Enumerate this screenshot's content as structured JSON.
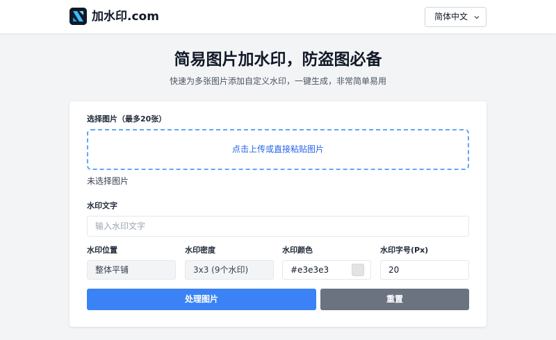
{
  "header": {
    "logo_icon": "brand-logo-icon",
    "brand": "加水印.com",
    "language": "简体中文"
  },
  "hero": {
    "title": "简易图片加水印，防盗图必备",
    "subtitle": "快速为多张图片添加自定义水印，一键生成，非常简单易用"
  },
  "form": {
    "image_label": "选择图片（最多20张）",
    "upload_text": "点击上传或直接粘贴图片",
    "no_image_text": "未选择图片",
    "text_label": "水印文字",
    "text_placeholder": "输入水印文字",
    "text_value": "",
    "position_label": "水印位置",
    "position_value": "整体平铺",
    "density_label": "水印密度",
    "density_value": "3x3 (9个水印)",
    "color_label": "水印颜色",
    "color_value": "#e3e3e3",
    "size_label": "水印字号(Px)",
    "size_value": "20",
    "process_button": "处理图片",
    "reset_button": "重置"
  },
  "colors": {
    "primary": "#3b82f6",
    "secondary": "#6b7280",
    "dropzone_border": "#60a5fa",
    "background": "#f3f4f6"
  }
}
